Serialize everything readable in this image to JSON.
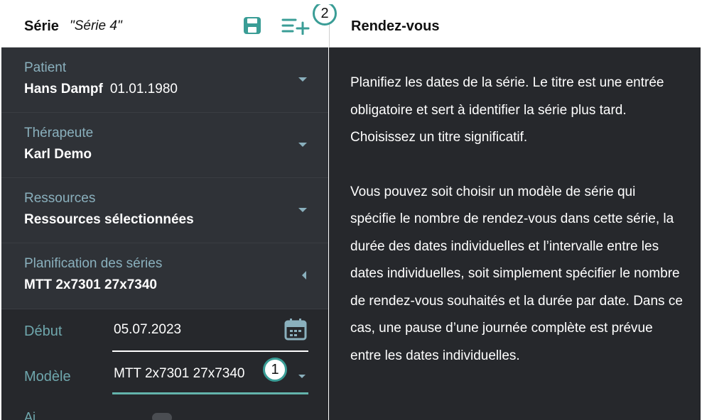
{
  "left": {
    "header": {
      "label": "Série",
      "name": "\"Série 4\""
    },
    "fields": [
      {
        "label": "Patient",
        "value": "Hans Dampf",
        "extra": "01.01.1980"
      },
      {
        "label": "Thérapeute",
        "value": "Karl Demo"
      },
      {
        "label": "Ressources",
        "value": "Ressources sélectionnées"
      },
      {
        "label": "Planification des séries",
        "value": "MTT 2x7301 27x7340"
      }
    ],
    "debut": {
      "label": "Début",
      "value": "05.07.2023"
    },
    "modele": {
      "label": "Modèle",
      "value": "MTT 2x7301 27x7340"
    },
    "partial_label": "Ai"
  },
  "callouts": {
    "one": "1",
    "two": "2"
  },
  "right": {
    "title": "Rendez-vous",
    "paragraphs": [
      "Planifiez les dates de la série. Le titre est une entrée obligatoire et sert à identifier la série plus tard. Choisissez un titre significatif.",
      "Vous pouvez soit choisir un modèle de série qui spécifie le nombre de rendez-vous dans cette série, la durée des dates individuelles et l’intervalle entre les dates individuelles, soit simplement spécifier le nombre de rendez-vous souhaités et la durée par date. Dans ce cas, une pause d’une journée complète est prévue entre les dates individuelles."
    ]
  },
  "colors": {
    "accent": "#3a9d96",
    "dark_bg": "#26282c",
    "field_bg": "#2f3237",
    "label": "#8ab0bd"
  },
  "icons": [
    "save-icon",
    "add-list-icon",
    "chevron-down-icon",
    "chevron-left-icon",
    "calendar-icon"
  ]
}
